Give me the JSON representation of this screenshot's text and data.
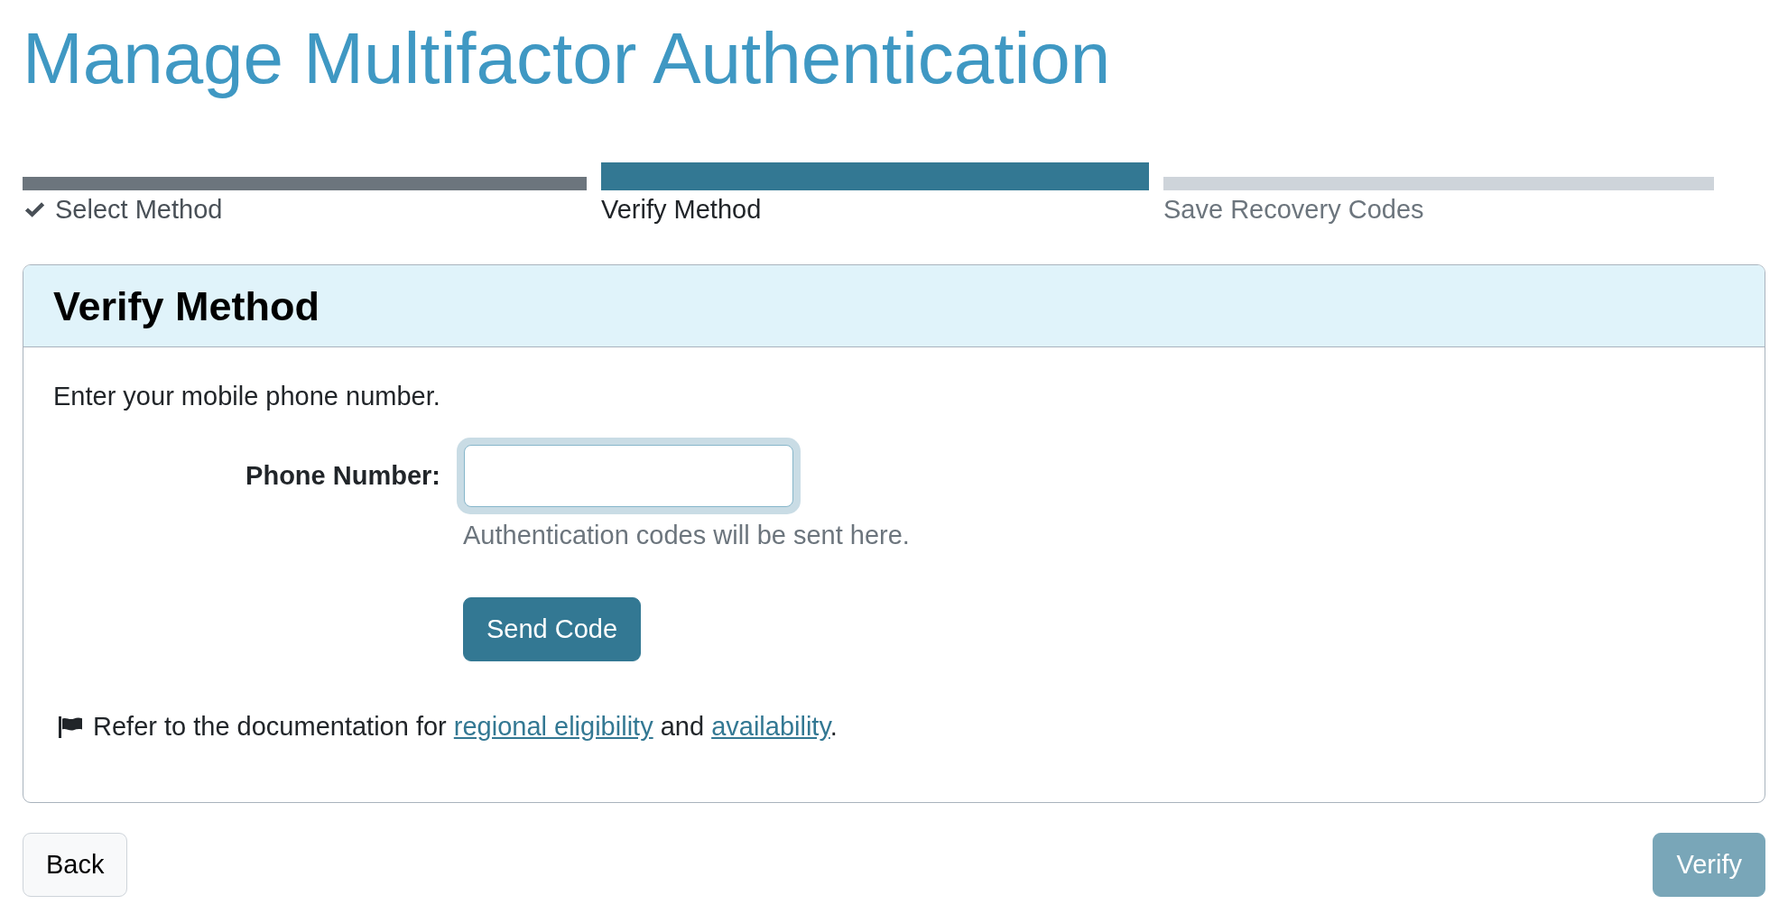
{
  "page": {
    "title": "Manage Multifactor Authentication"
  },
  "steps": [
    {
      "label": "Select Method",
      "completed": true,
      "current": false
    },
    {
      "label": "Verify Method",
      "completed": false,
      "current": true
    },
    {
      "label": "Save Recovery Codes",
      "completed": false,
      "current": false
    }
  ],
  "panel": {
    "title": "Verify Method",
    "instruction": "Enter your mobile phone number.",
    "phone_field": {
      "label": "Phone Number:",
      "focused": true,
      "help": "Authentication codes will be sent here."
    },
    "send_button": {
      "label": "Send Code"
    },
    "note": {
      "segments": [
        {
          "kind": "text",
          "text": "Refer to the documentation for "
        },
        {
          "kind": "link",
          "text": "regional eligibility"
        },
        {
          "kind": "text",
          "text": " and "
        },
        {
          "kind": "link",
          "text": "availability"
        },
        {
          "kind": "text",
          "text": "."
        }
      ]
    }
  },
  "buttons": [
    {
      "label": "Back",
      "kind": "secondary",
      "disabled": false
    },
    {
      "label": "Verify",
      "kind": "primary",
      "disabled": true
    }
  ]
}
